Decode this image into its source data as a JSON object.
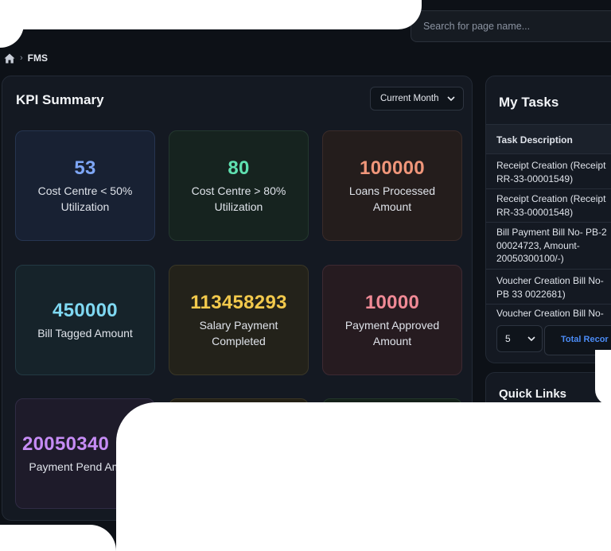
{
  "search": {
    "placeholder": "Search for page name..."
  },
  "breadcrumb": {
    "home_icon": "home-icon",
    "current": "FMS"
  },
  "kpi": {
    "title": "KPI Summary",
    "period": "Current Month",
    "cards": [
      {
        "value": "53",
        "label": "Cost Centre < 50% Utilization",
        "color": "#7ea6f5"
      },
      {
        "value": "80",
        "label": "Cost Centre > 80% Utilization",
        "color": "#5fe0b0"
      },
      {
        "value": "100000",
        "label": "Loans Processed Amount",
        "color": "#f0967a"
      },
      {
        "value": "450000",
        "label": "Bill Tagged Amount",
        "color": "#7fd8f2"
      },
      {
        "value": "113458293",
        "label": "Salary Payment Completed",
        "color": "#f2c94c"
      },
      {
        "value": "10000",
        "label": "Payment Approved Amount",
        "color": "#f08a96"
      },
      {
        "value": "20050340",
        "label": "Payment Pend Amount",
        "color": "#c68cf5"
      }
    ]
  },
  "tasks": {
    "title": "My Tasks",
    "column": "Task Description",
    "rows": [
      [
        "Receipt Creation (Receipt",
        "RR-33-00001549)"
      ],
      [
        "Receipt Creation (Receipt",
        "RR-33-00001548)"
      ],
      [
        "Bill Payment Bill No- PB-2",
        "00024723, Amount-",
        "20050300100/-)"
      ],
      [
        "Voucher Creation Bill No-",
        "PB 33 0022681)"
      ],
      [
        "Voucher Creation Bill No-"
      ]
    ],
    "page_size": "5",
    "total_label": "Total Recor"
  },
  "quick_links": {
    "title": "Quick Links"
  }
}
